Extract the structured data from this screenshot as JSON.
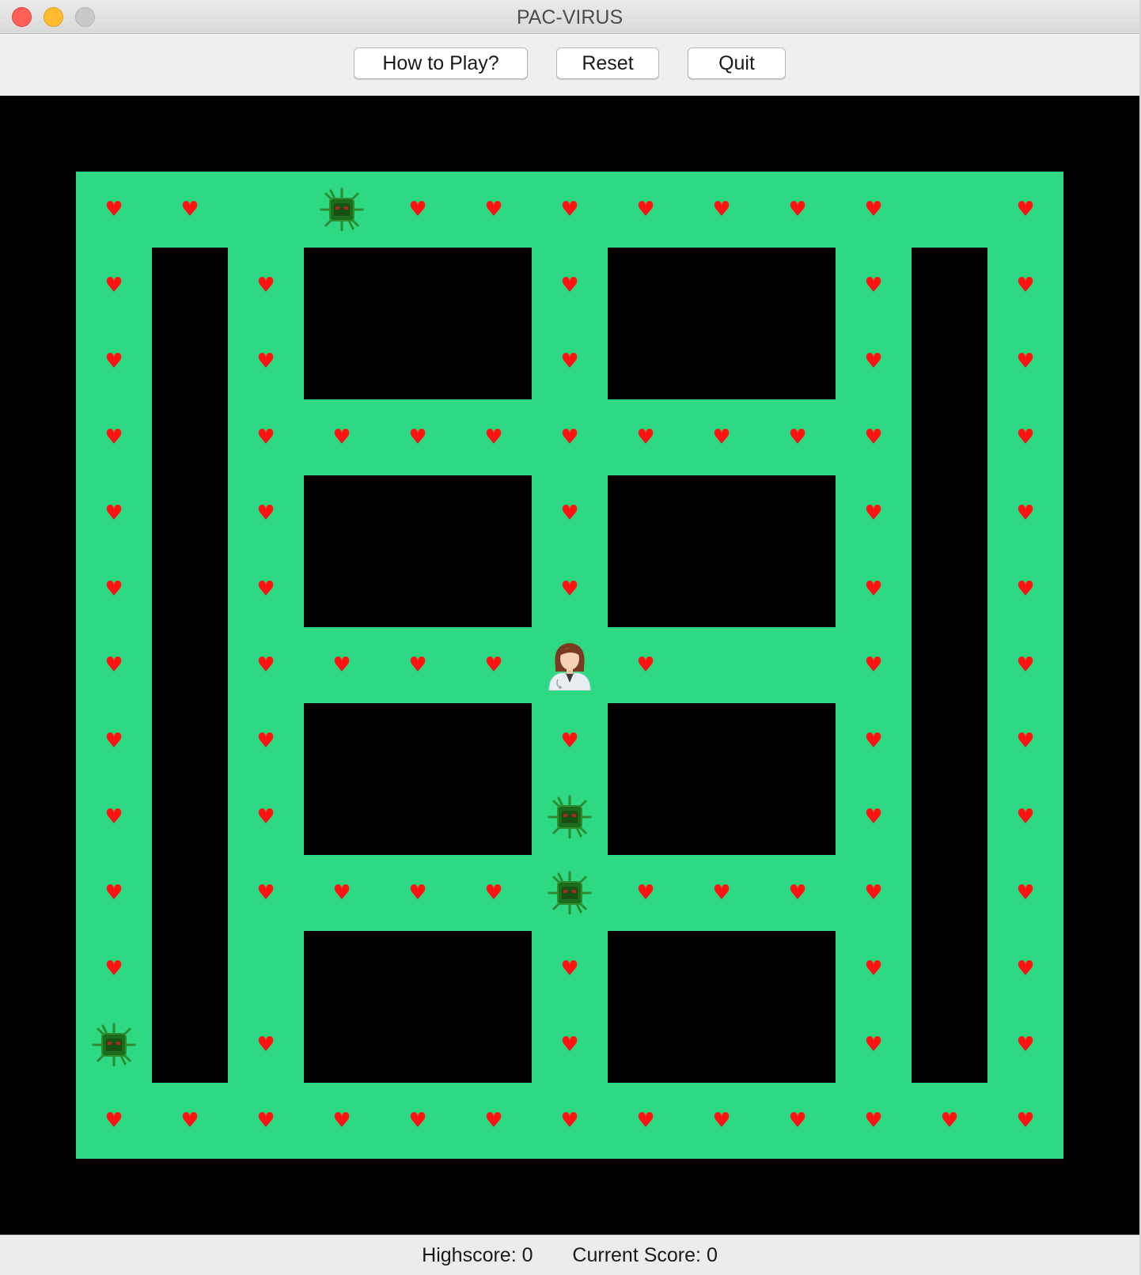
{
  "window": {
    "title": "PAC-VIRUS"
  },
  "toolbar": {
    "how_to_play_label": "How to Play?",
    "reset_label": "Reset",
    "quit_label": "Quit"
  },
  "status": {
    "highscore_label": "Highscore:",
    "highscore_value": "0",
    "current_score_label": "Current Score:",
    "current_score_value": "0"
  },
  "game": {
    "colors": {
      "path": "#2fd984",
      "wall": "#000000",
      "heart": "#ff1414",
      "virus": "#2e8b2e"
    },
    "grid_cols": 15,
    "grid_rows": 15,
    "maze": [
      "###############",
      "#.............#",
      "#.#.###.###.#.#",
      "#.#.###.###.#.#",
      "#.#.........#.#",
      "#.#.###.###.#.#",
      "#.#.###.###.#.#",
      "#.#.........#.#",
      "#.#.###.###.#.#",
      "#.#.###.###.#.#",
      "#.#.........#.#",
      "#.#.###.###.#.#",
      "#.#.###.###.#.#",
      "#.............#",
      "###############"
    ],
    "empty_cells": [
      [
        4,
        1
      ],
      [
        7,
        7
      ],
      [
        9,
        7
      ],
      [
        3,
        1
      ],
      [
        3,
        11
      ],
      [
        12,
        11
      ],
      [
        12,
        1
      ],
      [
        10,
        7
      ]
    ],
    "player": {
      "name": "doctor",
      "icon": "doctor-icon",
      "col": 7,
      "row": 7
    },
    "viruses": [
      {
        "icon": "virus-icon",
        "col": 4,
        "row": 1
      },
      {
        "icon": "virus-icon",
        "col": 7,
        "row": 9
      },
      {
        "icon": "virus-icon",
        "col": 7,
        "row": 10
      },
      {
        "icon": "virus-icon",
        "col": 1,
        "row": 12
      }
    ]
  }
}
